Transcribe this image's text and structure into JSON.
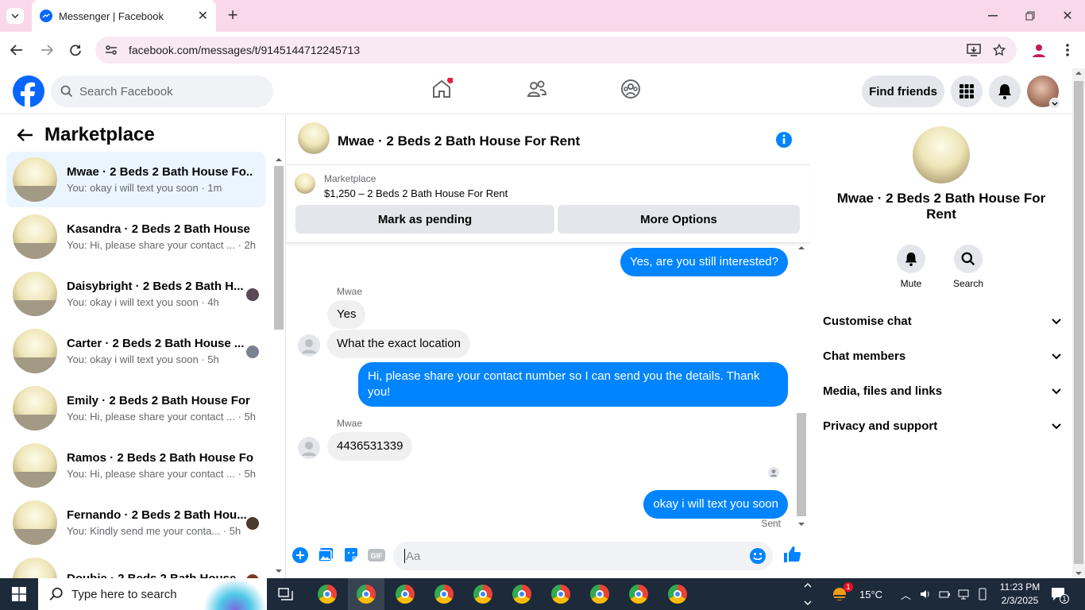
{
  "browser": {
    "tab_title": "Messenger | Facebook",
    "url": "facebook.com/messages/t/9145144712245713"
  },
  "fb": {
    "search_placeholder": "Search Facebook",
    "find_friends": "Find friends"
  },
  "sidebar": {
    "title": "Marketplace",
    "conversations": [
      {
        "name": "Mwae · 2 Beds 2 Bath House Fo...",
        "preview": "You: okay i will text you soon · 1m",
        "active": true
      },
      {
        "name": "Kasandra · 2 Beds 2 Bath House ...",
        "preview": "You: Hi, please share your contact ... · 2h"
      },
      {
        "name": "Daisybright · 2 Beds 2 Bath H...",
        "preview": "You: okay i will text you soon · 4h"
      },
      {
        "name": "Carter · 2 Beds 2 Bath House ...",
        "preview": "You: okay i will text you soon · 5h"
      },
      {
        "name": "Emily · 2 Beds 2 Bath House For ...",
        "preview": "You: Hi, please share your contact ... · 5h"
      },
      {
        "name": "Ramos · 2 Beds 2 Bath House Fo...",
        "preview": "You: Hi, please share your contact ... · 5h"
      },
      {
        "name": "Fernando · 2 Beds 2 Bath Hou...",
        "preview": "You: Kindly send me your conta... · 5h"
      },
      {
        "name": "Doubie · 2 Beds 2 Bath House...",
        "preview": ""
      }
    ]
  },
  "chat": {
    "title": "Mwae · 2 Beds 2 Bath House For Rent",
    "marketplace_label": "Marketplace",
    "listing": "$1,250 – 2 Beds 2 Bath House For Rent",
    "mark_pending": "Mark as pending",
    "more_options": "More Options",
    "messages": [
      {
        "dir": "out",
        "text": "Yes, are you still interested?"
      },
      {
        "dir": "sender",
        "text": "Mwae"
      },
      {
        "dir": "in",
        "text": "Yes"
      },
      {
        "dir": "in",
        "text": "What the exact location"
      },
      {
        "dir": "out",
        "text": "Hi, please share your contact number so I can send you the details. Thank you!"
      },
      {
        "dir": "sender",
        "text": "Mwae"
      },
      {
        "dir": "in",
        "text": "4436531339"
      },
      {
        "dir": "out",
        "text": "okay i will text you soon"
      }
    ],
    "sent_status": "Sent",
    "input_placeholder": "Aa"
  },
  "details": {
    "name": "Mwae · 2 Beds 2 Bath House For Rent",
    "mute": "Mute",
    "search": "Search",
    "sections": [
      "Customise chat",
      "Chat members",
      "Media, files and links",
      "Privacy and support"
    ]
  },
  "taskbar": {
    "search_placeholder": "Type here to search",
    "temperature": "15°C",
    "time": "11:23 PM",
    "date": "2/3/2025",
    "weather_badge": "1",
    "notif_count": "1"
  },
  "colors": {
    "accent": "#0084ff",
    "fb_blue": "#0866ff",
    "tab_bg": "#f9d8eb"
  }
}
